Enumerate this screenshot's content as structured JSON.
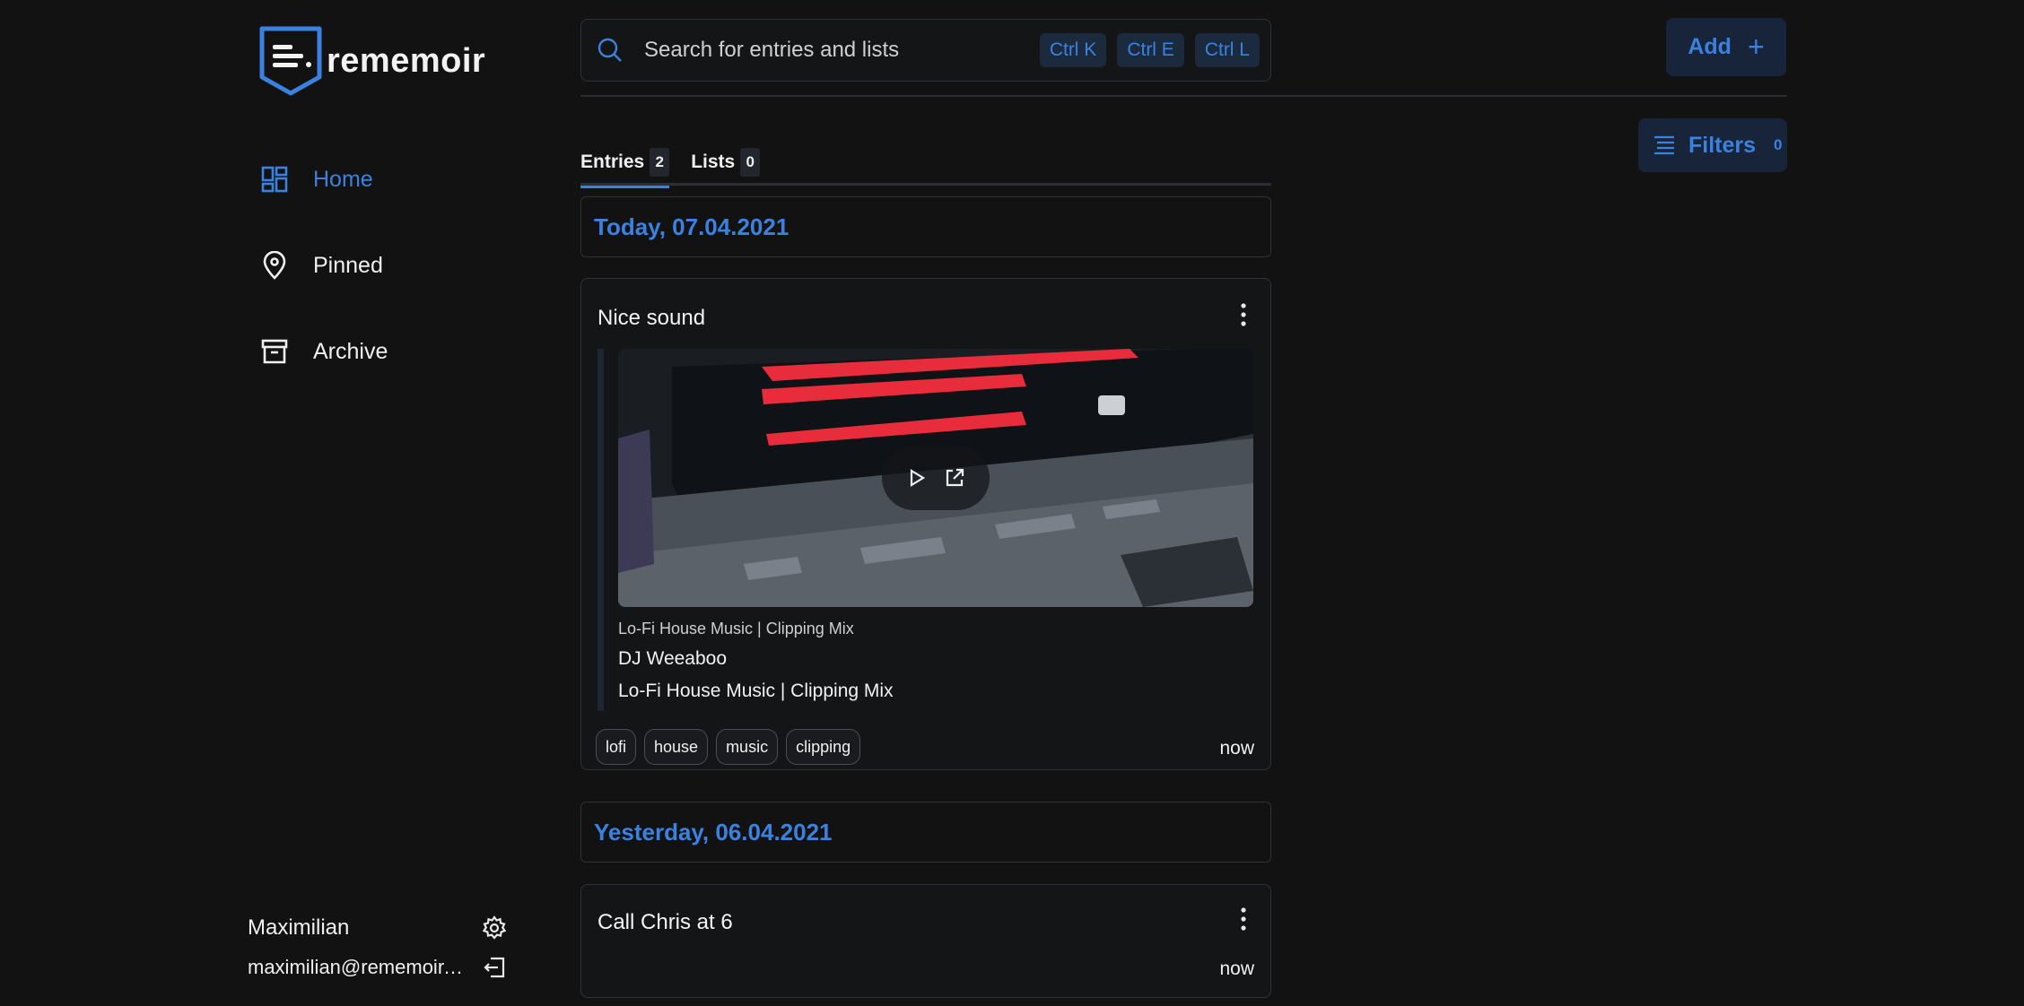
{
  "app": {
    "logo_text": "rememoir"
  },
  "sidebar": {
    "items": [
      {
        "label": "Home",
        "icon": "dashboard-icon",
        "active": true
      },
      {
        "label": "Pinned",
        "icon": "pin-icon",
        "active": false
      },
      {
        "label": "Archive",
        "icon": "archive-icon",
        "active": false
      }
    ]
  },
  "user": {
    "name": "Maximilian",
    "email": "maximilian@rememoir.d..."
  },
  "search": {
    "placeholder": "Search for entries and lists",
    "shortcuts": [
      "Ctrl K",
      "Ctrl E",
      "Ctrl L"
    ]
  },
  "toolbar": {
    "add_label": "Add",
    "add_icon": "+",
    "filters_label": "Filters",
    "filters_count": "0"
  },
  "tabs": [
    {
      "label": "Entries",
      "count": "2",
      "active": true
    },
    {
      "label": "Lists",
      "count": "0",
      "active": false
    }
  ],
  "feed": {
    "days": [
      {
        "header": "Today, 07.04.2021",
        "entries": [
          {
            "title": "Nice sound",
            "link": {
              "site": "Lo-Fi House Music | Clipping Mix",
              "author": "DJ Weeaboo",
              "title": "Lo-Fi House Music | Clipping Mix"
            },
            "tags": [
              "lofi",
              "house",
              "music",
              "clipping"
            ],
            "time": "now"
          }
        ]
      },
      {
        "header": "Yesterday, 06.04.2021",
        "entries": [
          {
            "title": "Call Chris at 6",
            "time": "now"
          }
        ]
      }
    ]
  },
  "colors": {
    "background": "#121212",
    "accent": "#3b82e0",
    "surface": "#141517",
    "border": "#2e3136"
  }
}
